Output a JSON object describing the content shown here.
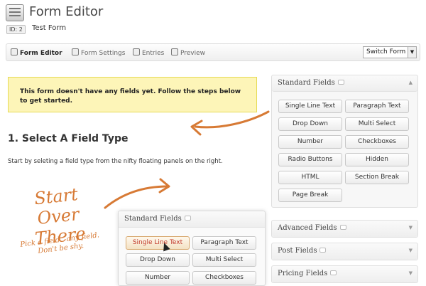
{
  "header": {
    "title": "Form Editor",
    "id_label": "ID: 2",
    "form_name": "Test Form"
  },
  "toolbar": {
    "items": [
      "Form Editor",
      "Form Settings",
      "Entries",
      "Preview"
    ],
    "switch_label": "Switch Form"
  },
  "notice": {
    "text": "This form doesn't have any fields yet. Follow the steps below to get started."
  },
  "step": {
    "title": "1. Select A Field Type",
    "text": "Start by seleting a field type from the nifty floating panels on the right."
  },
  "annotation": {
    "big": "Start Over There",
    "small": "Pick a field.. any field. Don't be shy."
  },
  "panels": {
    "standard": {
      "title": "Standard Fields",
      "buttons": [
        "Single Line Text",
        "Paragraph Text",
        "Drop Down",
        "Multi Select",
        "Number",
        "Checkboxes",
        "Radio Buttons",
        "Hidden",
        "HTML",
        "Section Break",
        "Page Break"
      ]
    },
    "advanced": {
      "title": "Advanced Fields"
    },
    "post": {
      "title": "Post Fields"
    },
    "pricing": {
      "title": "Pricing Fields"
    }
  },
  "demo_panel": {
    "title": "Standard Fields",
    "buttons": [
      "Single Line Text",
      "Paragraph Text",
      "Drop Down",
      "Multi Select",
      "Number",
      "Checkboxes"
    ]
  },
  "colors": {
    "notice_bg": "#fdf5b8",
    "annotation": "#d77a35"
  }
}
